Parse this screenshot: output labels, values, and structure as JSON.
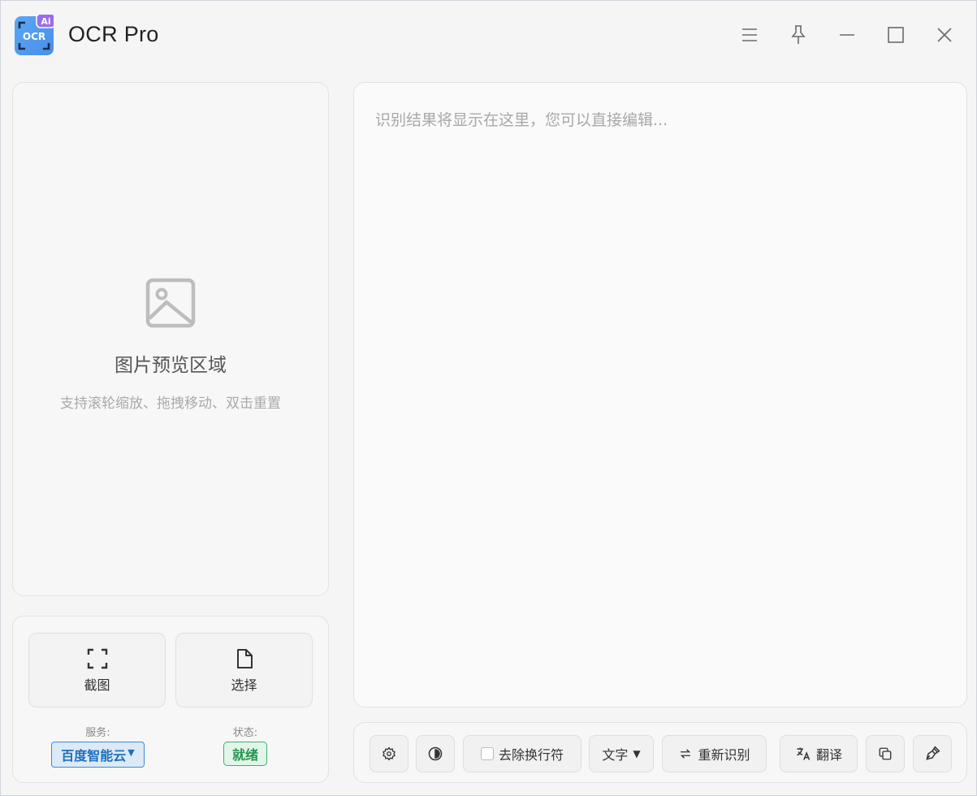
{
  "app": {
    "title": "OCR Pro",
    "logo_text": "OCR",
    "logo_badge": "Ai"
  },
  "preview": {
    "title": "图片预览区域",
    "hint": "支持滚轮缩放、拖拽移动、双击重置"
  },
  "controls": {
    "screenshot_label": "截图",
    "select_label": "选择",
    "service_label": "服务:",
    "service_value": "百度智能云",
    "status_label": "状态:",
    "status_value": "就绪"
  },
  "result": {
    "placeholder": "识别结果将显示在这里，您可以直接编辑..."
  },
  "toolbar": {
    "remove_linebreak_label": "去除换行符",
    "mode_value": "文字",
    "mode_caret": "▼",
    "reocr_label": "重新识别",
    "translate_label": "翻译"
  },
  "icons": {
    "menu": "menu-icon",
    "pin": "pin-icon",
    "minimize": "minimize-icon",
    "maximize": "maximize-icon",
    "close": "close-icon"
  },
  "colors": {
    "accent": "#3f8bd6",
    "success": "#23954e",
    "logo_gradient_start": "#5aa7f5",
    "logo_badge": "#9b6cf0"
  }
}
